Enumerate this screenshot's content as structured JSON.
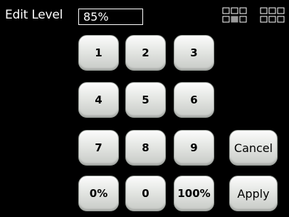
{
  "header": {
    "title": "Edit Level",
    "current_value": "85%"
  },
  "keypad": {
    "row1": [
      "1",
      "2",
      "3"
    ],
    "row2": [
      "4",
      "5",
      "6"
    ],
    "row3": [
      "7",
      "8",
      "9"
    ],
    "row4": [
      "0%",
      "0",
      "100%"
    ]
  },
  "actions": {
    "cancel_label": "Cancel",
    "apply_label": "Apply"
  },
  "indicators": {
    "grid_icon_left": "grid-selector-icon",
    "grid_icon_right": "grid-selector-icon",
    "highlight_color": "#9a9a9a",
    "outline_color": "#ffffff"
  }
}
